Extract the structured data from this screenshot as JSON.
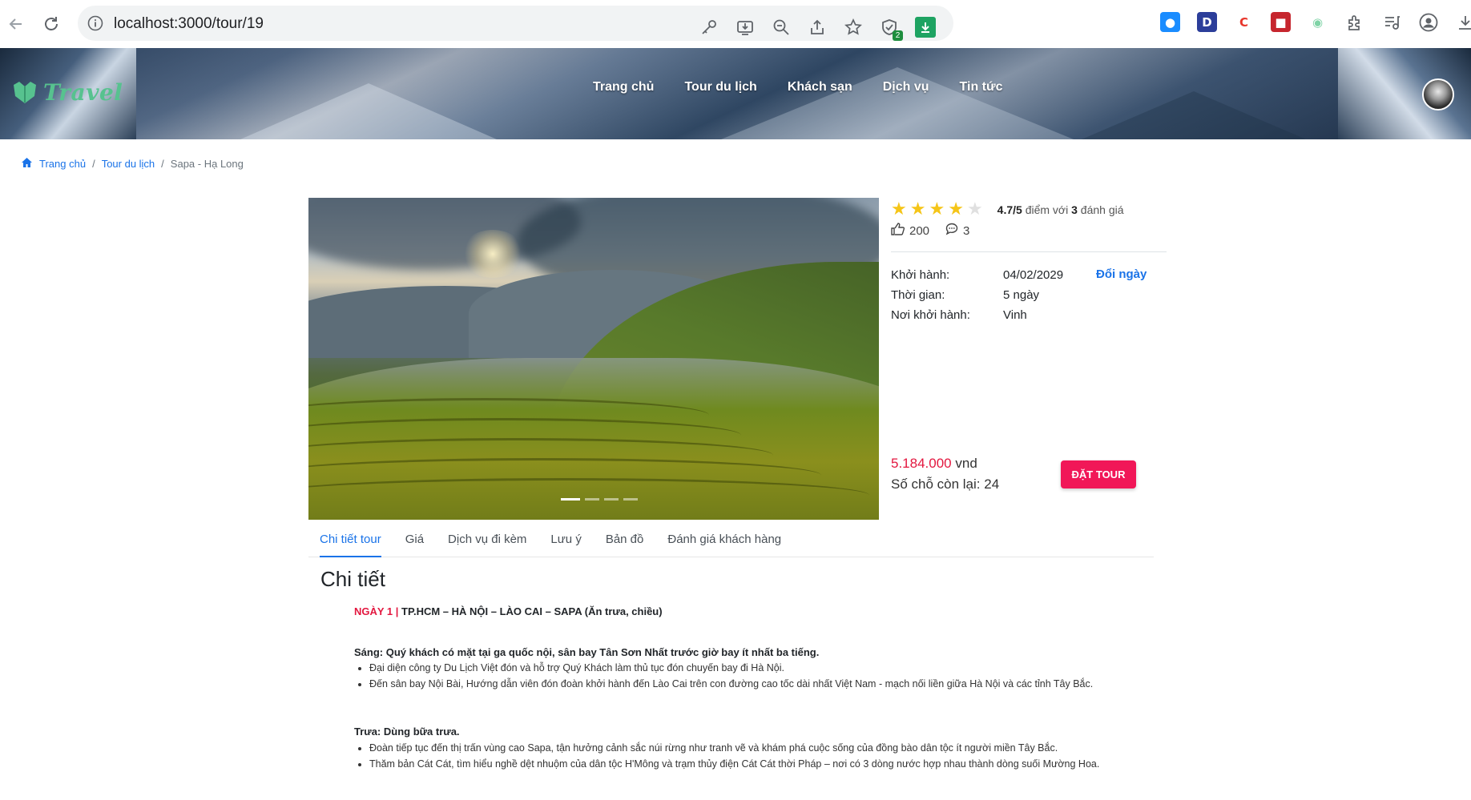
{
  "browser": {
    "url": "localhost:3000/tour/19",
    "icons": [
      "back-icon",
      "reload-icon",
      "info-icon",
      "key-icon",
      "install-icon",
      "zoom-out-icon",
      "share-icon",
      "bookmark-star-icon",
      "extension-check-icon",
      "download-extension-icon"
    ],
    "extension_badge": "2",
    "extensions": [
      {
        "name": "raindrop-icon",
        "glyph": "●",
        "color": "#1a8cff"
      },
      {
        "name": "dashlane-icon",
        "glyph": "D",
        "color": "#2c3e9a"
      },
      {
        "name": "c-icon",
        "glyph": "C",
        "color": "#e8362b"
      },
      {
        "name": "puzzle-red-icon",
        "glyph": "■",
        "color": "#c6262e"
      },
      {
        "name": "circle-ext-icon",
        "glyph": "◉",
        "color": "#7fd3a6"
      },
      {
        "name": "extensions-icon",
        "glyph": "",
        "color": ""
      },
      {
        "name": "reading-list-icon",
        "glyph": "",
        "color": ""
      },
      {
        "name": "profile-icon",
        "glyph": "",
        "color": ""
      }
    ]
  },
  "header": {
    "logo_text": "Travel",
    "nav": [
      "Trang chủ",
      "Tour du lịch",
      "Khách sạn",
      "Dịch vụ",
      "Tin tức"
    ]
  },
  "breadcrumb": {
    "home": "Trang chủ",
    "level1": "Tour du lịch",
    "current": "Sapa - Hạ Long",
    "separator": "/"
  },
  "tour": {
    "rating": 4.7,
    "rating_text_score": "4.7/5",
    "rating_text_mid": " điểm với ",
    "rating_count": "3",
    "rating_text_end": " đánh giá",
    "likes": "200",
    "comments": "3",
    "departure_label": "Khởi hành:",
    "departure_value": "04/02/2029",
    "change_date": "Đổi ngày",
    "duration_label": "Thời gian:",
    "duration_value": "5 ngày",
    "origin_label": "Nơi khởi hành:",
    "origin_value": "Vinh",
    "price_amount": "5.184.000",
    "price_unit": " vnd",
    "seats_text": "Số chỗ còn lại: 24",
    "book_button": "ĐẶT TOUR",
    "slider_count": 4,
    "slider_active": 1
  },
  "tabs": [
    "Chi tiết tour",
    "Giá",
    "Dịch vụ đi kèm",
    "Lưu ý",
    "Bản đồ",
    "Đánh giá khách hàng"
  ],
  "detail": {
    "title": "Chi tiết",
    "day_label": "NGÀY 1 | ",
    "day_title": "TP.HCM – HÀ NỘI – LÀO CAI – SAPA (Ăn trưa, chiều)",
    "morning_head": "Sáng:  Quý khách có mặt tại ga quốc nội, sân bay Tân Sơn Nhất trước giờ bay ít nhất ba tiếng.",
    "morning_items": [
      "Đại diện công ty Du Lịch Việt đón và hỗ trợ Quý Khách làm thủ tục đón chuyến bay đi Hà Nội.",
      "Đến sân bay Nội Bài, Hướng dẫn viên đón đoàn khởi hành đến Lào Cai trên con đường cao tốc dài nhất Việt Nam - mạch nối liền giữa Hà Nội và các tỉnh Tây Bắc."
    ],
    "noon_head": "Trưa:  Dùng bữa trưa.",
    "noon_items": [
      "Đoàn tiếp tục đến thị trấn vùng cao Sapa, tận hưởng cảnh sắc núi rừng như tranh vẽ và khám phá cuộc sống của đồng bào dân tộc ít người miền Tây Bắc.",
      "Thăm bản Cát Cát, tìm hiểu nghề dệt nhuộm của dân tộc H'Mông và trạm thủy điện Cát Cát thời Pháp – nơi có 3 dòng nước hợp nhau thành dòng suối Mường Hoa."
    ]
  },
  "colors": {
    "accent": "#1a73e8",
    "price": "#e3173f",
    "book_button": "#f11758",
    "star": "#f5c518",
    "logo": "#57c28f"
  }
}
